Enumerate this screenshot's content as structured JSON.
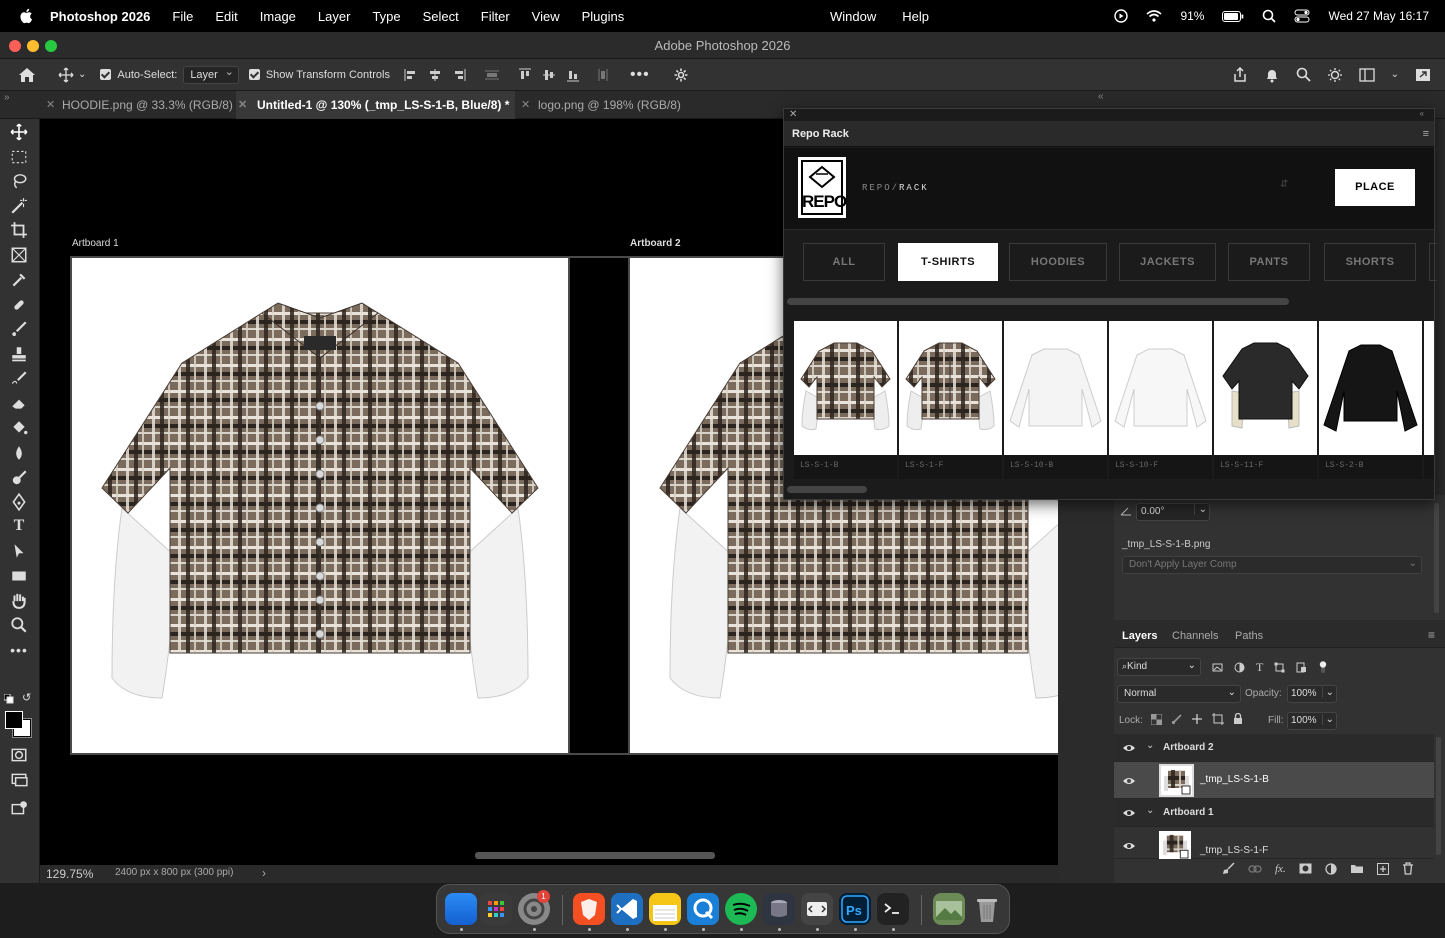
{
  "menubar": {
    "app_name": "Photoshop 2026",
    "items": [
      "File",
      "Edit",
      "Image",
      "Layer",
      "Type",
      "Select",
      "Filter",
      "View",
      "Plugins"
    ],
    "center_items": [
      "Window",
      "Help"
    ],
    "battery": "91%",
    "datetime": "Wed 27 May  16:17"
  },
  "window": {
    "title": "Adobe Photoshop 2026"
  },
  "options": {
    "auto_select_label": "Auto-Select:",
    "auto_select_value": "Layer",
    "transform_label": "Show Transform Controls"
  },
  "tabs": [
    {
      "label": "HOODIE.png @ 33.3% (RGB/8)"
    },
    {
      "label": "Untitled-1 @ 130% (_tmp_LS-S-1-B, Blue/8) *"
    },
    {
      "label": "logo.png @ 198% (RGB/8)"
    }
  ],
  "canvas": {
    "artboard1": "Artboard 1",
    "artboard2": "Artboard 2"
  },
  "status": {
    "zoom": "129.75%",
    "doc_info": "2400 px x 800 px (300 ppi)",
    "arrow": "›"
  },
  "repo": {
    "panel_title": "Repo Rack",
    "logo_text": "REPO",
    "brand_prefix": "REPO/",
    "brand_suffix": "RACK",
    "place_label": "PLACE",
    "categories": [
      "ALL",
      "T-SHIRTS",
      "HOODIES",
      "JACKETS",
      "PANTS",
      "SHORTS"
    ],
    "active_category": "T-SHIRTS",
    "items": [
      {
        "code": "LS-S-1-B",
        "style": "plaid"
      },
      {
        "code": "LS-S-1-F",
        "style": "plaid"
      },
      {
        "code": "LS-S-10-B",
        "style": "white"
      },
      {
        "code": "LS-S-10-F",
        "style": "white"
      },
      {
        "code": "LS-S-11-F",
        "style": "black-cream"
      },
      {
        "code": "LS-S-2-B",
        "style": "black"
      }
    ]
  },
  "properties": {
    "angle": "0.00°",
    "filename": "_tmp_LS-S-1-B.png",
    "layer_comp": "Don't Apply Layer Comp"
  },
  "layers_panel": {
    "tabs": [
      "Layers",
      "Channels",
      "Paths"
    ],
    "filter_kind": "Kind",
    "blend_mode": "Normal",
    "opacity_label": "Opacity:",
    "opacity_value": "100%",
    "lock_label": "Lock:",
    "fill_label": "Fill:",
    "fill_value": "100%",
    "rows": [
      {
        "name": "Artboard 2",
        "type": "group"
      },
      {
        "name": "_tmp_LS-S-1-B",
        "type": "layer",
        "selected": true
      },
      {
        "name": "Artboard 1",
        "type": "group"
      },
      {
        "name": "_tmp_LS-S-1-F",
        "type": "layer",
        "selected": false
      }
    ]
  },
  "colors": {
    "plaid_base": "#7a6a5c",
    "accent_red": "#e0443a"
  }
}
